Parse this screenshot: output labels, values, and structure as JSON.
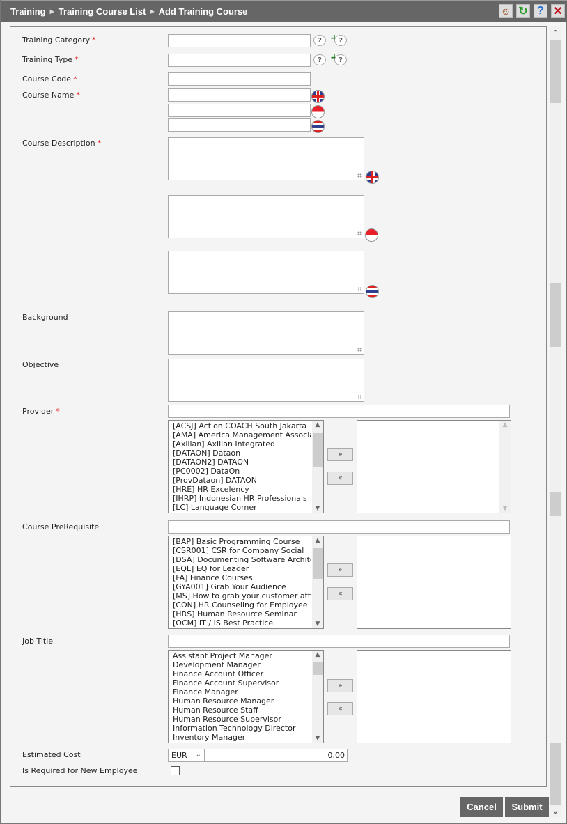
{
  "breadcrumb": {
    "items": [
      "Training",
      "Training Course List",
      "Add Training Course"
    ],
    "separator": "▶"
  },
  "title_icons": {
    "support": "☺",
    "refresh": "↻",
    "help": "?",
    "close": "✕"
  },
  "form": {
    "required_marker": "*",
    "training_category": {
      "label": "Training Category",
      "value": ""
    },
    "training_type": {
      "label": "Training Type",
      "value": ""
    },
    "course_code": {
      "label": "Course Code",
      "value": ""
    },
    "course_name": {
      "label": "Course Name",
      "values": {
        "en": "",
        "id": "",
        "th": ""
      }
    },
    "course_description": {
      "label": "Course Description",
      "values": {
        "en": "",
        "id": "",
        "th": ""
      }
    },
    "background": {
      "label": "Background",
      "value": ""
    },
    "objective": {
      "label": "Objective",
      "value": ""
    },
    "provider": {
      "label": "Provider",
      "filter_value": "",
      "available": [
        "[ACSJ] Action COACH South Jakarta",
        "[AMA] America Management Association",
        "[Axilian] Axilian Integrated",
        "[DATAON] Dataon",
        "[DATAON2] DATAON",
        "[PC0002] DataOn",
        "[ProvDataon] DATAON",
        "[HRE] HR Excelency",
        "[IHRP] Indonesian HR Professionals",
        "[LC] Language Corner"
      ],
      "selected": []
    },
    "course_prerequisite": {
      "label": "Course PreRequisite",
      "filter_value": "",
      "available": [
        "[BAP] Basic Programming Course",
        "[CSR001] CSR for Company Social",
        "[DSA] Documenting Software Architecture",
        "[EQL] EQ for Leader",
        "[FA] Finance Courses",
        "[GYA001] Grab Your Audience",
        "[MS] How to grab your customer attention",
        "[CON] HR Counseling for Employee",
        "[HRS] Human Resource Seminar",
        "[OCM] IT / IS Best Practice"
      ],
      "selected": []
    },
    "job_title": {
      "label": "Job Title",
      "filter_value": "",
      "available": [
        "Assistant Project Manager",
        "Development Manager",
        "Finance Account Officer",
        "Finance Account Supervisor",
        "Finance Manager",
        "Human Resource Manager",
        "Human Resource Staff",
        "Human Resource Supervisor",
        "Information Technology Director",
        "Inventory Manager"
      ],
      "selected": []
    },
    "estimated_cost": {
      "label": "Estimated Cost",
      "currency": "EUR",
      "amount": "0.00"
    },
    "is_required_new_employee": {
      "label": "Is Required for New Employee",
      "checked": false
    },
    "move_right_label": "»",
    "move_left_label": "«",
    "help_glyph": "?",
    "add_glyph": "+"
  },
  "actions": {
    "cancel": "Cancel",
    "submit": "Submit"
  },
  "colors": {
    "titlebar": "#666666",
    "required": "#e02020",
    "button": "#666666",
    "panel": "#f4f4f4"
  }
}
